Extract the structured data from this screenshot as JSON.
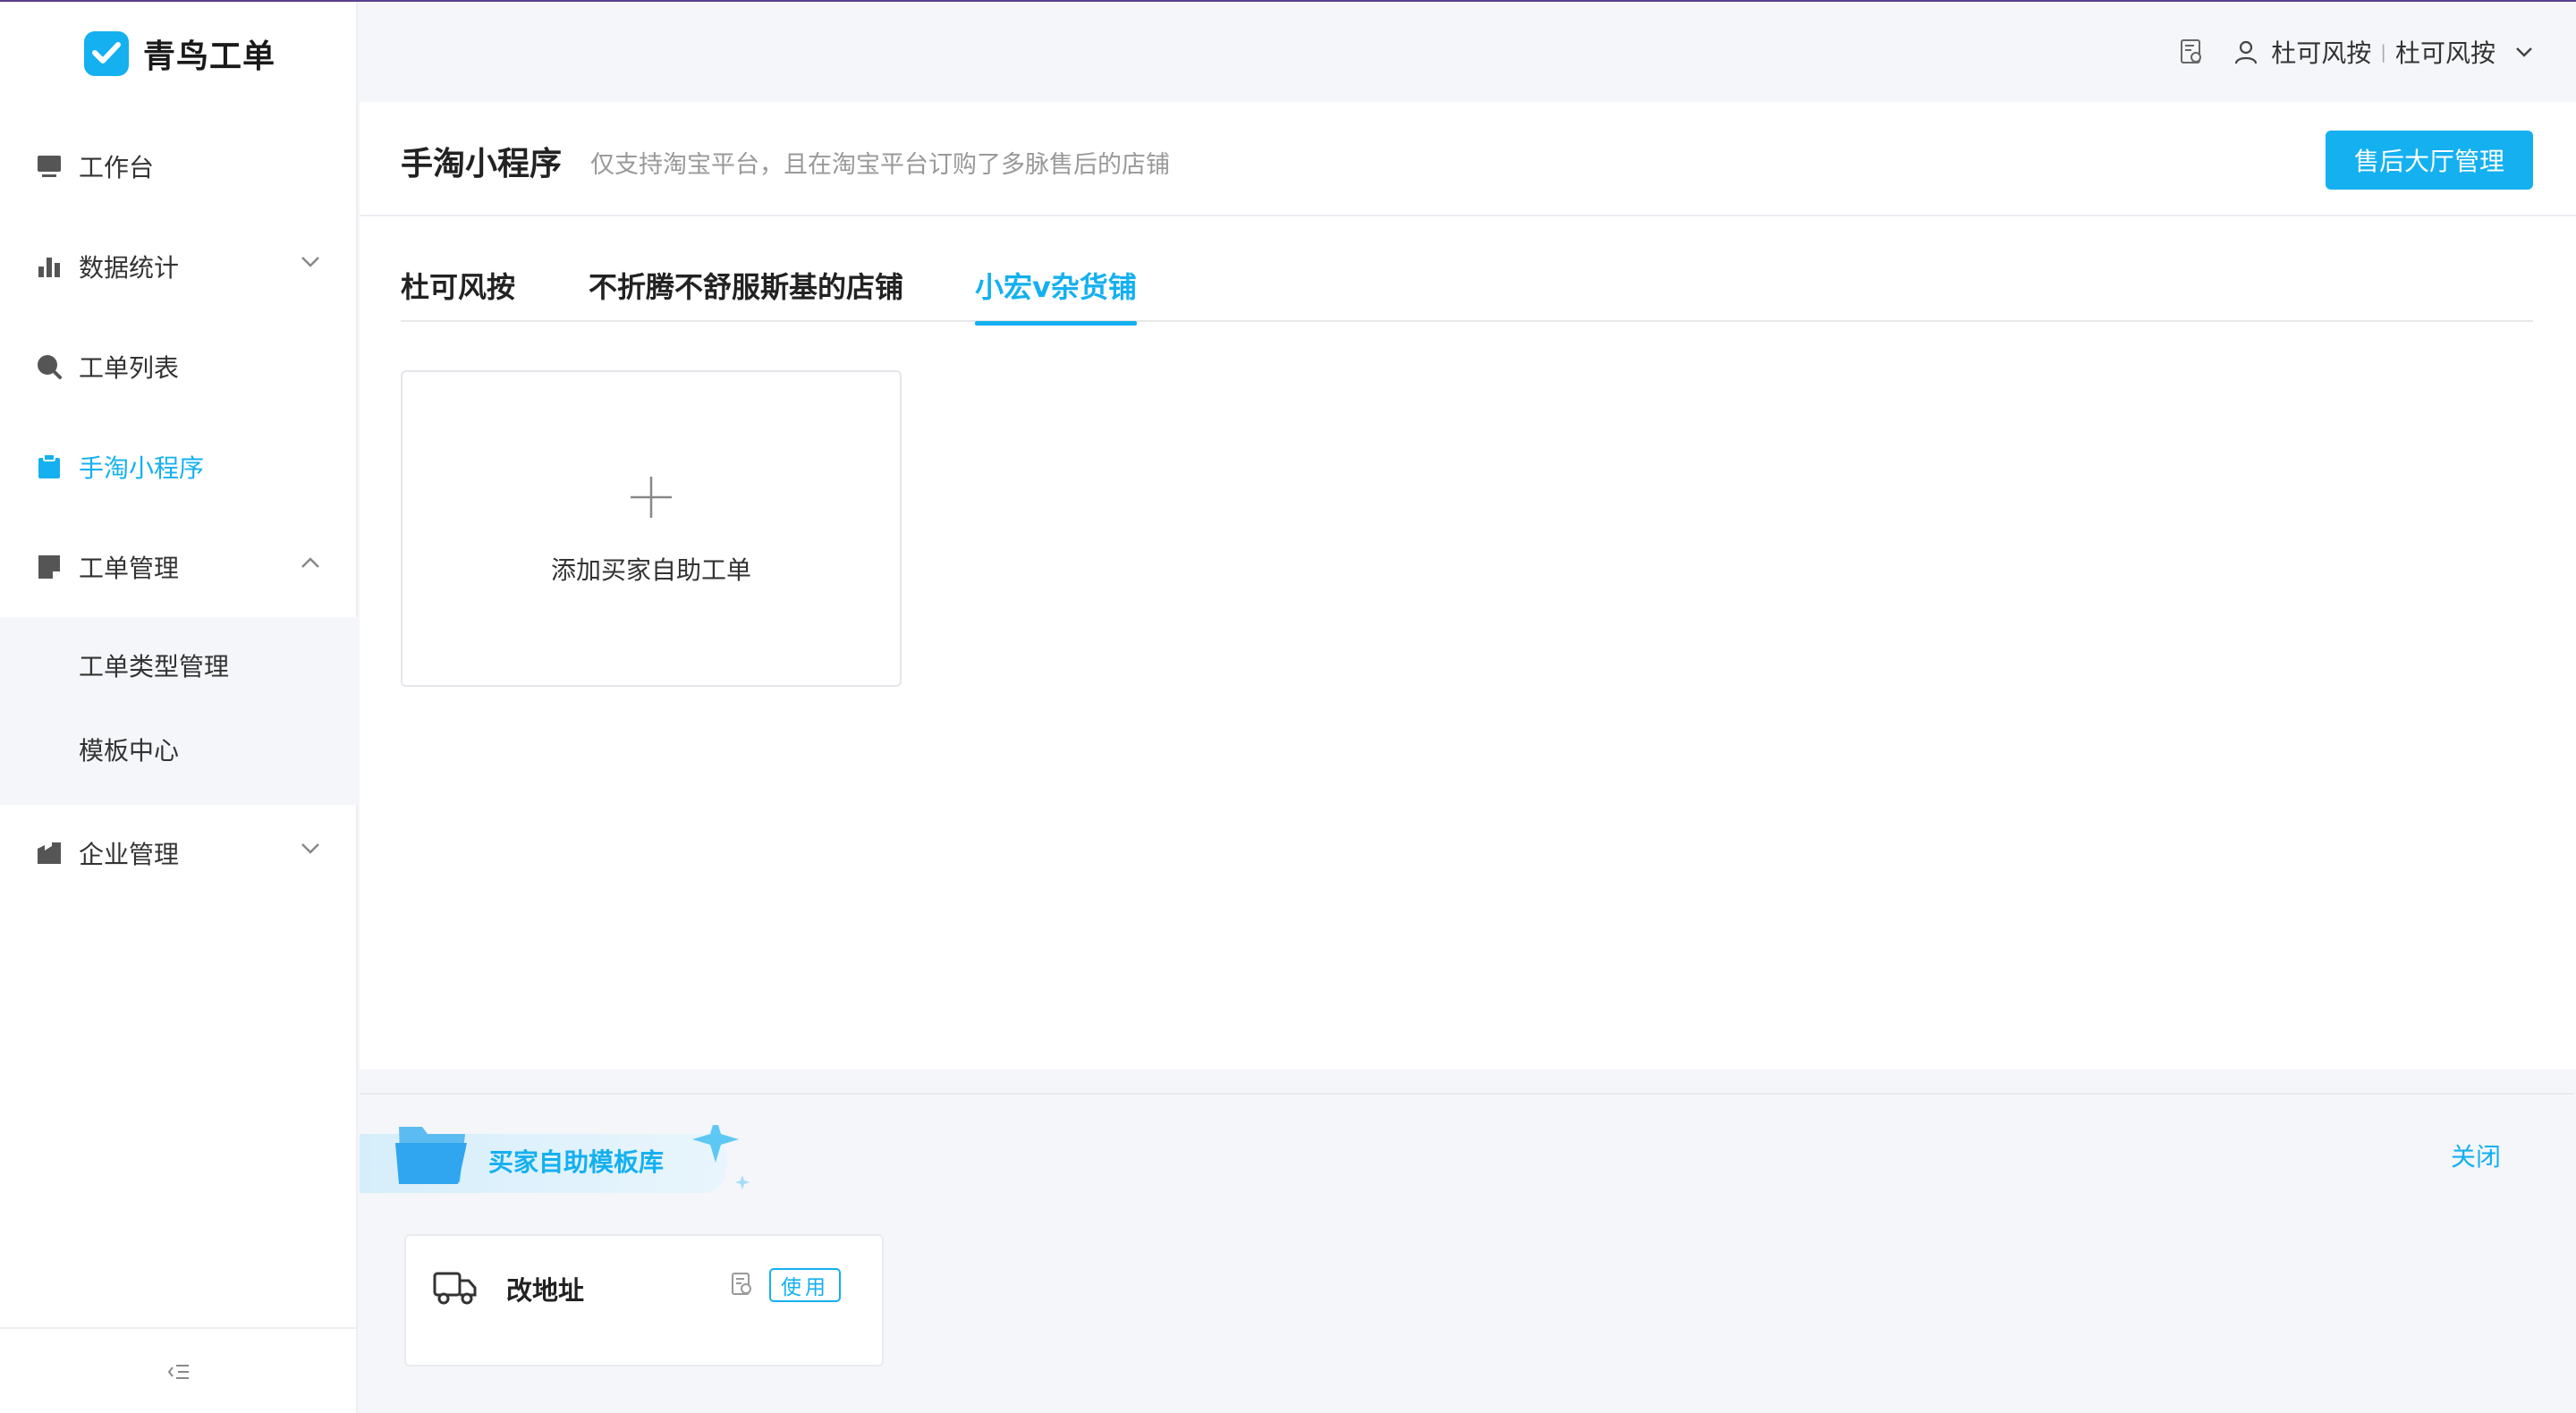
{
  "app": {
    "name": "青鸟工单",
    "accent": "#14b0f0"
  },
  "sidebar": {
    "items": [
      {
        "label": "工作台",
        "icon": "monitor-icon"
      },
      {
        "label": "数据统计",
        "icon": "bar-chart-icon",
        "chevron": "down"
      },
      {
        "label": "工单列表",
        "icon": "search-icon"
      },
      {
        "label": "手淘小程序",
        "icon": "clipboard-icon",
        "active": true
      },
      {
        "label": "工单管理",
        "icon": "note-icon",
        "chevron": "up"
      },
      {
        "label": "企业管理",
        "icon": "building-icon",
        "chevron": "down"
      }
    ],
    "subitems": [
      {
        "label": "工单类型管理"
      },
      {
        "label": "模板中心"
      }
    ]
  },
  "header": {
    "user_shop": "杜可风按",
    "user_name": "杜可风按",
    "separator": "|"
  },
  "page": {
    "title": "手淘小程序",
    "description": "仅支持淘宝平台，且在淘宝平台订购了多脉售后的店铺",
    "primary_button": "售后大厅管理"
  },
  "tabs": [
    {
      "label": "杜可风按"
    },
    {
      "label": "不折腾不舒服斯基的店铺"
    },
    {
      "label": "小宏v杂货铺",
      "active": true
    }
  ],
  "add_card": {
    "label": "添加买家自助工单"
  },
  "library": {
    "title": "买家自助模板库",
    "close_label": "关闭",
    "templates": [
      {
        "name": "改地址",
        "use_label": "使用"
      }
    ]
  }
}
